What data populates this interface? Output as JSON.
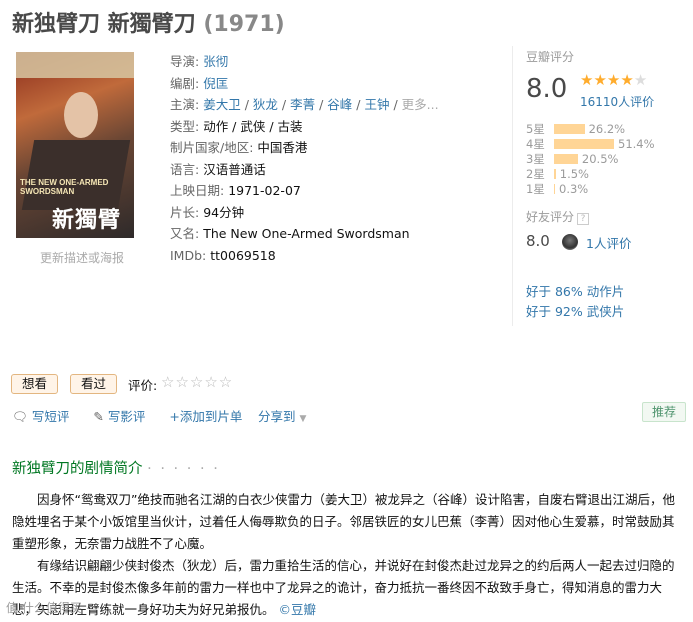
{
  "movie": {
    "title": "新独臂刀 新獨臂刀",
    "year": "(1971)"
  },
  "poster": {
    "update_link": "更新描述或海报",
    "art_text_main": "新獨臂刀",
    "art_text_sub": "THE NEW ONE-ARMED SWORDSMAN"
  },
  "info": {
    "director_label": "导演:",
    "director": "张彻",
    "writer_label": "编剧:",
    "writer": "倪匡",
    "cast_label": "主演:",
    "cast": [
      "姜大卫",
      "狄龙",
      "李菁",
      "谷峰",
      "王钟"
    ],
    "cast_sep": " / ",
    "cast_more": "更多...",
    "genre_label": "类型:",
    "genres": "动作 / 武侠 / 古装",
    "country_label": "制片国家/地区:",
    "country": "中国香港",
    "language_label": "语言:",
    "language": "汉语普通话",
    "release_label": "上映日期:",
    "release": "1971-02-07",
    "runtime_label": "片长:",
    "runtime": "94分钟",
    "aka_label": "又名:",
    "aka": "The New One-Armed Swordsman",
    "imdb_label": "IMDb:",
    "imdb": "tt0069518"
  },
  "rating": {
    "label": "豆瓣评分",
    "score": "8.0",
    "stars_full": 4,
    "stars_total": 5,
    "votes": "16110人评价",
    "distribution": [
      {
        "label": "5星",
        "pct": "26.2%",
        "value": 26.2
      },
      {
        "label": "4星",
        "pct": "51.4%",
        "value": 51.4
      },
      {
        "label": "3星",
        "pct": "20.5%",
        "value": 20.5
      },
      {
        "label": "2星",
        "pct": "1.5%",
        "value": 1.5
      },
      {
        "label": "1星",
        "pct": "0.3%",
        "value": 0.3
      }
    ],
    "bar_color": "#ffd596",
    "star_color": "#ffac2d"
  },
  "friends": {
    "label": "好友评分",
    "help": "?",
    "score": "8.0",
    "votes": "1人评价"
  },
  "better_than": [
    "好于 86% 动作片",
    "好于 92% 武侠片"
  ],
  "actions": {
    "want": "想看",
    "seen": "看过",
    "rate_label": "评价:",
    "rate_stars": "☆☆☆☆☆"
  },
  "tools": {
    "short_review": "写短评",
    "review": "写影评",
    "add_list": "+添加到片单",
    "share": "分享到",
    "recommend": "推荐"
  },
  "summary": {
    "title": "新独臂刀的剧情简介",
    "dots": "· · · · · ·",
    "paragraphs": [
      "因身怀“鸳鸯双刀”绝技而驰名江湖的白衣少侠雷力（姜大卫）被龙异之（谷峰）设计陷害，自废右臂退出江湖后，他隐姓埋名于某个小饭馆里当伙计，过着任人侮辱欺负的日子。邻居铁匠的女儿巴蕉（李菁）因对他心生爱慕，时常鼓励其重塑形象，无奈雷力战胜不了心魔。",
      "有缘结识翩翩少侠封俊杰（狄龙）后，雷力重拾生活的信心，并说好在封俊杰赴过龙异之的约后两人一起去过归隐的生活。不幸的是封俊杰像多年前的雷力一样也中了龙异之的诡计，奋力抵抗一番终因不敌致手身亡，得知消息的雷力大悲，矢志用左臂练就一身好功夫为好兄弟报仇。"
    ],
    "copyright": "©豆瓣"
  },
  "watermark": "值 什么值得买"
}
